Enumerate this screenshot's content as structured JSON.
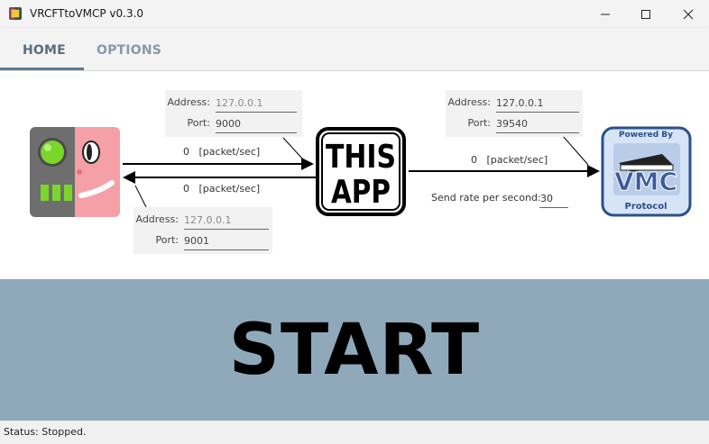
{
  "window": {
    "title": "VRCFTtoVMCP v0.3.0"
  },
  "tabs": [
    {
      "label": "HOME"
    },
    {
      "label": "OPTIONS"
    }
  ],
  "receive": {
    "address_label": "Address:",
    "address_value": "127.0.0.1",
    "port_label": "Port:",
    "port_value": "9000",
    "rate": "0",
    "rate_unit": "[packet/sec]"
  },
  "reply": {
    "address_label": "Address:",
    "address_value": "127.0.0.1",
    "port_label": "Port:",
    "port_value": "9001",
    "rate": "0",
    "rate_unit": "[packet/sec]"
  },
  "send": {
    "address_label": "Address:",
    "address_value": "127.0.0.1",
    "port_label": "Port:",
    "port_value": "39540",
    "rate": "0",
    "rate_unit": "[packet/sec]",
    "send_rate_label": "Send rate per second:",
    "send_rate_value": "30"
  },
  "this_app": {
    "line1": "THIS",
    "line2": "APP"
  },
  "vmc_logo": {
    "top": "Powered By",
    "main": "VMC",
    "bottom": "Protocol"
  },
  "start_button": {
    "label": "START"
  },
  "status": {
    "text": "Status: Stopped."
  },
  "colors": {
    "accent": "#5b7a96",
    "start_bg": "#8fa9ba",
    "vmc_blue": "#3a5c9e"
  }
}
